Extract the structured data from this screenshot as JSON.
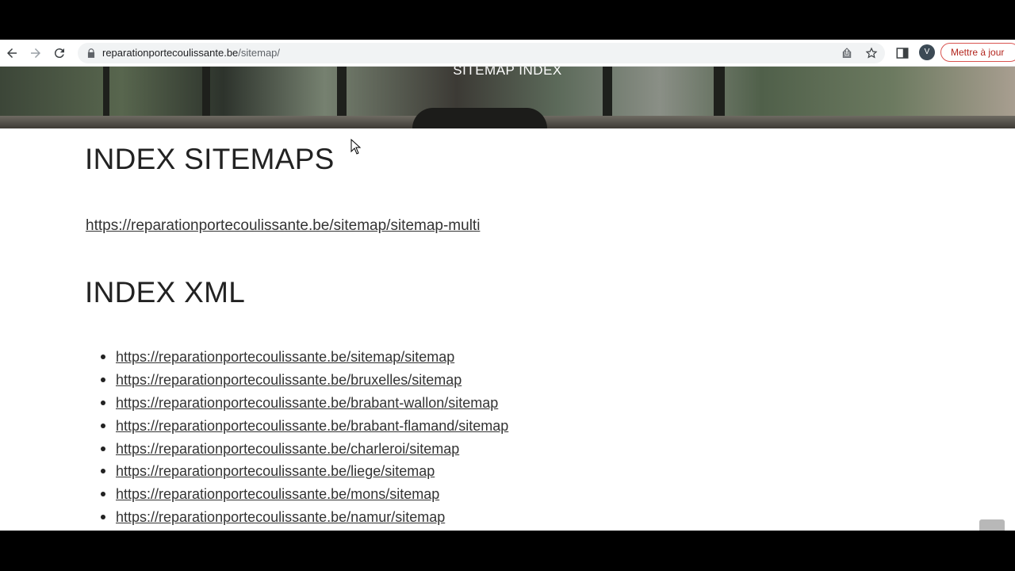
{
  "browser": {
    "url_host": "reparationportecoulissante.be",
    "url_path": "/sitemap/",
    "profile_initial": "V",
    "update_label": "Mettre à jour"
  },
  "hero": {
    "title": "SITEMAP INDEX"
  },
  "sitemaps_section": {
    "heading": "INDEX SITEMAPS",
    "link": "https://reparationportecoulissante.be/sitemap/sitemap-multi"
  },
  "xml_section": {
    "heading": "INDEX XML",
    "links": [
      "https://reparationportecoulissante.be/sitemap/sitemap",
      "https://reparationportecoulissante.be/bruxelles/sitemap",
      "https://reparationportecoulissante.be/brabant-wallon/sitemap",
      "https://reparationportecoulissante.be/brabant-flamand/sitemap",
      "https://reparationportecoulissante.be/charleroi/sitemap",
      "https://reparationportecoulissante.be/liege/sitemap",
      "https://reparationportecoulissante.be/mons/sitemap",
      "https://reparationportecoulissante.be/namur/sitemap"
    ]
  }
}
